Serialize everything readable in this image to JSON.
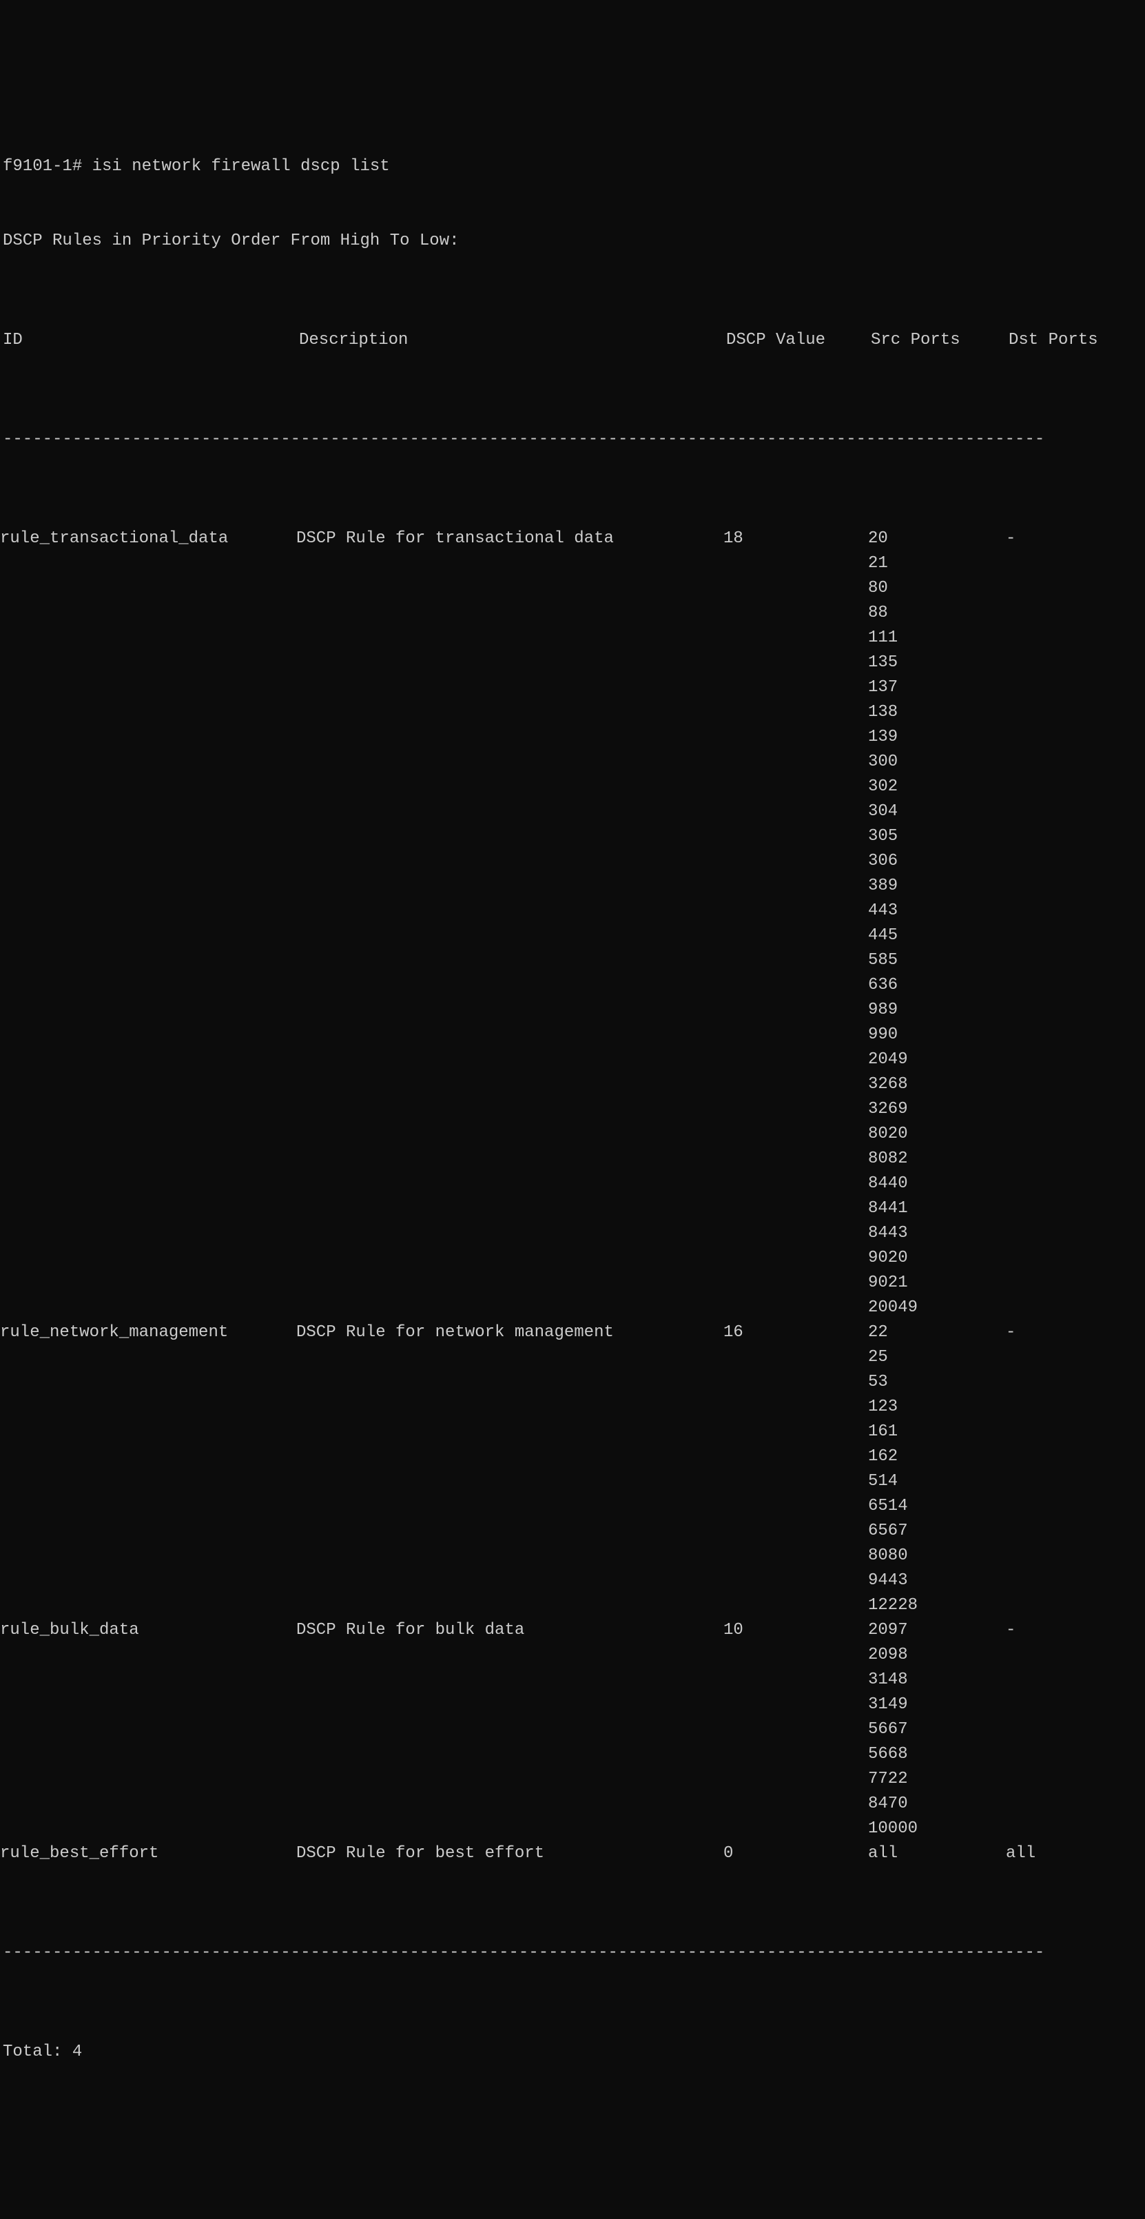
{
  "prompt_line": "f9101-1# isi network firewall dscp list",
  "sub_header": "DSCP Rules in Priority Order From High To Low:",
  "headers": {
    "id": "ID",
    "description": "Description",
    "dscp_value": "DSCP Value",
    "src_ports": "Src Ports",
    "dst_ports": "Dst Ports"
  },
  "separator": "---------------------------------------------------------------------------------------------------------",
  "rules": [
    {
      "id": "rule_transactional_data",
      "description": "DSCP Rule for transactional data",
      "dscp_value": "18",
      "src_ports": [
        "20",
        "21",
        "80",
        "88",
        "111",
        "135",
        "137",
        "138",
        "139",
        "300",
        "302",
        "304",
        "305",
        "306",
        "389",
        "443",
        "445",
        "585",
        "636",
        "989",
        "990",
        "2049",
        "3268",
        "3269",
        "8020",
        "8082",
        "8440",
        "8441",
        "8443",
        "9020",
        "9021",
        "20049"
      ],
      "dst_ports": "-"
    },
    {
      "id": "rule_network_management",
      "description": "DSCP Rule for network management",
      "dscp_value": "16",
      "src_ports": [
        "22",
        "25",
        "53",
        "123",
        "161",
        "162",
        "514",
        "6514",
        "6567",
        "8080",
        "9443",
        "12228"
      ],
      "dst_ports": "-"
    },
    {
      "id": "rule_bulk_data",
      "description": "DSCP Rule for bulk data",
      "dscp_value": "10",
      "src_ports": [
        "2097",
        "2098",
        "3148",
        "3149",
        "5667",
        "5668",
        "7722",
        "8470",
        "10000"
      ],
      "dst_ports": "-"
    },
    {
      "id": "rule_best_effort",
      "description": "DSCP Rule for best effort",
      "dscp_value": "0",
      "src_ports": [
        "all"
      ],
      "dst_ports": "all"
    }
  ],
  "footer": "Total: 4"
}
